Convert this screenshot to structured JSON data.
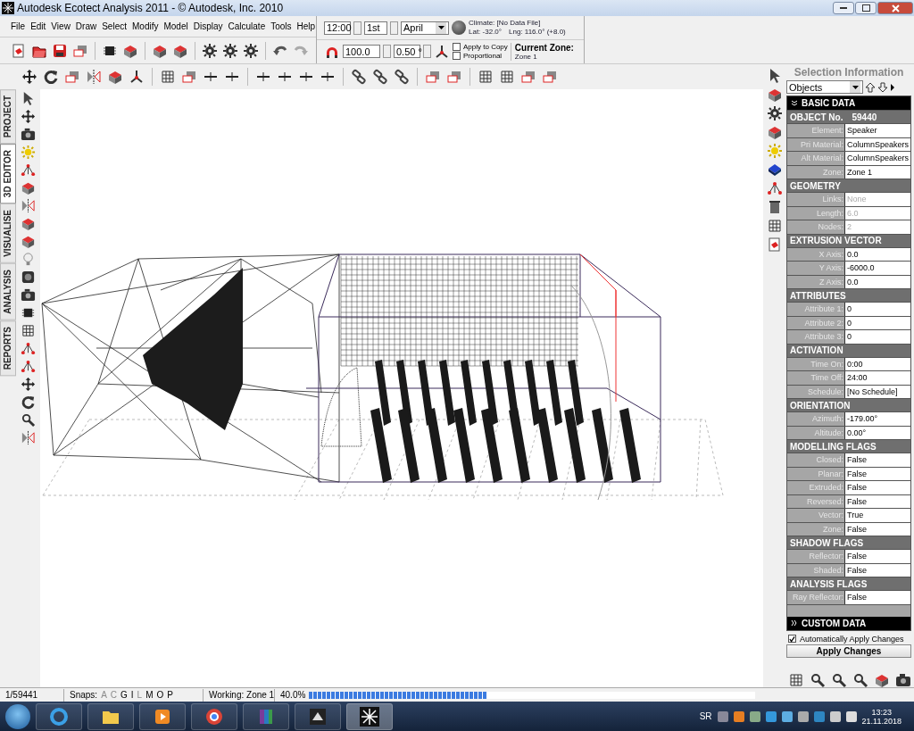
{
  "window": {
    "title": "Autodesk Ecotect Analysis 2011 - © Autodesk, Inc. 2010"
  },
  "menu": [
    "File",
    "Edit",
    "View",
    "Draw",
    "Select",
    "Modify",
    "Model",
    "Display",
    "Calculate",
    "Tools",
    "Help"
  ],
  "date_controls": {
    "time": "12:00",
    "day": "1st",
    "month": "April"
  },
  "climate": {
    "label": "Climate: [No Data File]",
    "lat": "Lat: -32.0°",
    "lng": "Lng: 116.0° (+8.0)"
  },
  "transform": {
    "scale": "100.0",
    "angle": "0.50 °",
    "options": [
      {
        "label": "Apply to Copy",
        "checked": false
      },
      {
        "label": "Proportional",
        "checked": false
      }
    ]
  },
  "current_zone": {
    "label": "Current Zone:",
    "value": "Zone 1"
  },
  "side_tabs": [
    {
      "label": "PROJECT",
      "selected": false
    },
    {
      "label": "3D EDITOR",
      "selected": true
    },
    {
      "label": "VISUALISE",
      "selected": false
    },
    {
      "label": "ANALYSIS",
      "selected": false
    },
    {
      "label": "REPORTS",
      "selected": false
    }
  ],
  "selection_panel": {
    "title": "Selection Information",
    "filter": "Objects",
    "groups": [
      {
        "title": "BASIC DATA",
        "expanded": true,
        "sections": [
          {
            "title": "OBJECT No.",
            "value": "59440",
            "rows": [
              {
                "label": "Element:",
                "value": "Speaker",
                "disabled": false
              },
              {
                "label": "Pri Material:",
                "value": "ColumnSpeakers",
                "disabled": false
              },
              {
                "label": "Alt Material:",
                "value": "ColumnSpeakers",
                "disabled": false
              },
              {
                "label": "Zone:",
                "value": "Zone 1",
                "disabled": false
              }
            ]
          },
          {
            "title": "GEOMETRY",
            "rows": [
              {
                "label": "Links:",
                "value": "None",
                "disabled": true
              },
              {
                "label": "Length:",
                "value": "6.0",
                "disabled": true
              },
              {
                "label": "Nodes:",
                "value": "2",
                "disabled": true
              }
            ]
          },
          {
            "title": "EXTRUSION VECTOR",
            "rows": [
              {
                "label": "X Axis:",
                "value": "0.0",
                "disabled": false
              },
              {
                "label": "Y Axis:",
                "value": "-6000.0",
                "disabled": false
              },
              {
                "label": "Z Axis:",
                "value": "0.0",
                "disabled": false
              }
            ]
          },
          {
            "title": "ATTRIBUTES",
            "rows": [
              {
                "label": "Attribute 1:",
                "value": "0",
                "disabled": false
              },
              {
                "label": "Attribute 2:",
                "value": "0",
                "disabled": false
              },
              {
                "label": "Attribute 3:",
                "value": "0",
                "disabled": false
              }
            ]
          },
          {
            "title": "ACTIVATION",
            "rows": [
              {
                "label": "Time On:",
                "value": "0:00",
                "disabled": false
              },
              {
                "label": "Time Off:",
                "value": "24:00",
                "disabled": false
              },
              {
                "label": "Schedule:",
                "value": "[No Schedule]",
                "disabled": false
              }
            ]
          },
          {
            "title": "ORIENTATION",
            "rows": [
              {
                "label": "Azimuth:",
                "value": "-179.00°",
                "disabled": false
              },
              {
                "label": "Altitude:",
                "value": "0.00°",
                "disabled": false
              }
            ]
          },
          {
            "title": "MODELLING FLAGS",
            "rows": [
              {
                "label": "Closed:",
                "value": "False",
                "disabled": false
              },
              {
                "label": "Planar:",
                "value": "False",
                "disabled": false
              },
              {
                "label": "Extruded:",
                "value": "False",
                "disabled": false
              },
              {
                "label": "Reversed:",
                "value": "False",
                "disabled": false
              },
              {
                "label": "Vector:",
                "value": "True",
                "disabled": false
              },
              {
                "label": "Zone:",
                "value": "False",
                "disabled": false
              }
            ]
          },
          {
            "title": "SHADOW FLAGS",
            "rows": [
              {
                "label": "Reflector:",
                "value": "False",
                "disabled": false
              },
              {
                "label": "Shaded:",
                "value": "False",
                "disabled": false
              }
            ]
          },
          {
            "title": "ANALYSIS FLAGS",
            "rows": [
              {
                "label": "Ray Reflector:",
                "value": "False",
                "disabled": false
              }
            ]
          }
        ]
      },
      {
        "title": "CUSTOM DATA",
        "expanded": false
      }
    ],
    "auto_apply": {
      "label": "Automatically Apply Changes",
      "checked": true
    },
    "apply_button": "Apply Changes"
  },
  "status_bar": {
    "count": "1/59441",
    "snaps_label": "Snaps:",
    "snaps": [
      {
        "letter": "A",
        "on": false
      },
      {
        "letter": "C",
        "on": false
      },
      {
        "letter": "G",
        "on": true
      },
      {
        "letter": "I",
        "on": true
      },
      {
        "letter": "L",
        "on": false
      },
      {
        "letter": "M",
        "on": true
      },
      {
        "letter": "O",
        "on": true
      },
      {
        "letter": "P",
        "on": true
      }
    ],
    "working": "Working: Zone 1",
    "progress_text": "40.0%",
    "progress": {
      "level": 0.4
    }
  },
  "taskbar": {
    "language": "SR",
    "time": "13:23",
    "date": "21.11.2018"
  }
}
